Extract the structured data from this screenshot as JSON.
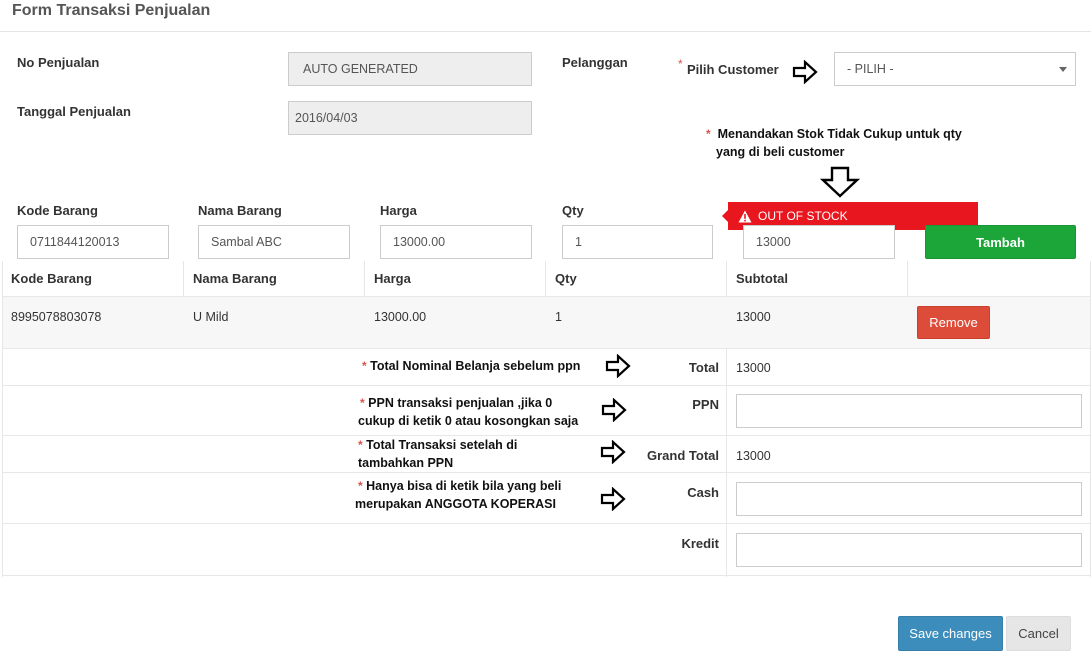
{
  "form": {
    "title": "Form Transaksi Penjualan",
    "no_penjualan_label": "No Penjualan",
    "no_penjualan_value": "AUTO GENERATED",
    "tanggal_label": "Tanggal Penjualan",
    "tanggal_value": "2016/04/03",
    "pelanggan_label": "Pelanggan",
    "pilih_customer_label": "Pilih Customer",
    "customer_select_value": "- PILIH -"
  },
  "entry": {
    "kode_label": "Kode Barang",
    "kode_value": "0711844120013",
    "nama_label": "Nama Barang",
    "nama_value": "Sambal ABC",
    "harga_label": "Harga",
    "harga_value": "13000.00",
    "qty_label": "Qty",
    "qty_value": "1",
    "subtotal_value": "13000",
    "alert": "OUT OF STOCK",
    "tambah_button": "Tambah"
  },
  "table": {
    "headers": [
      "Kode Barang",
      "Nama Barang",
      "Harga",
      "Qty",
      "Subtotal"
    ],
    "rows": [
      {
        "kode": "8995078803078",
        "nama": "U Mild",
        "harga": "13000.00",
        "qty": "1",
        "subtotal": "13000",
        "action": "Remove"
      }
    ]
  },
  "totals": {
    "total_label": "Total",
    "total_value": "13000",
    "ppn_label": "PPN",
    "ppn_value": "",
    "grand_total_label": "Grand Total",
    "grand_total_value": "13000",
    "cash_label": "Cash",
    "cash_value": "",
    "kredit_label": "Kredit",
    "kredit_value": ""
  },
  "annotations": {
    "stock_line1": "Menandakan Stok Tidak Cukup untuk qty",
    "stock_line2": "yang di beli customer",
    "total_note": "Total Nominal Belanja sebelum ppn",
    "ppn_line1": "PPN transaksi penjualan ,jika 0",
    "ppn_line2": "cukup di ketik 0 atau kosongkan saja",
    "grand_line1": "Total Transaksi setelah di",
    "grand_line2": "tambahkan PPN",
    "cash_line1": "Hanya bisa di ketik bila yang beli",
    "cash_line2": "merupakan ANGGOTA KOPERASI"
  },
  "footer": {
    "save_button": "Save changes",
    "cancel_button": "Cancel"
  },
  "colors": {
    "primary": "#3c8dbc",
    "success": "#1ca63a",
    "danger": "#dd4b39",
    "alert": "#e8161f"
  }
}
